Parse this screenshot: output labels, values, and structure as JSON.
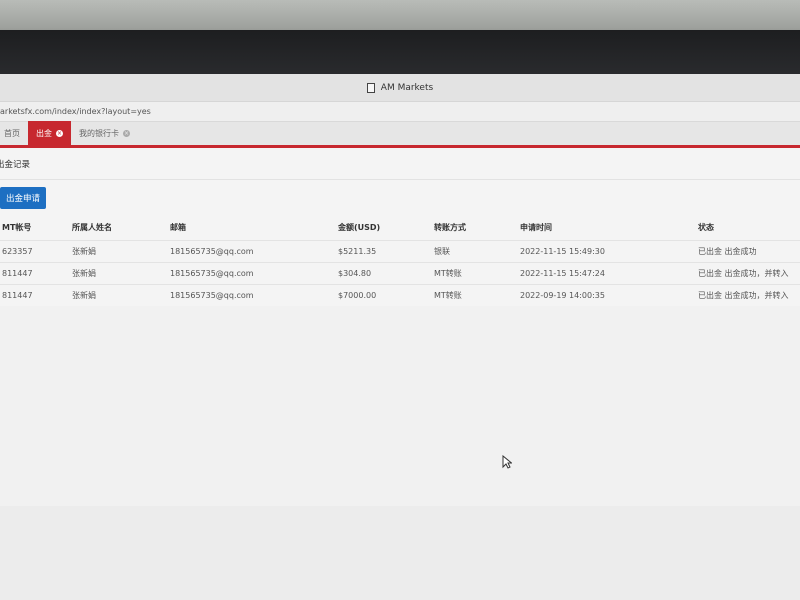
{
  "window": {
    "title": "AM Markets"
  },
  "address_bar": {
    "url": "arketsfx.com/index/index?layout=yes"
  },
  "tabs": [
    {
      "label": "首页",
      "active": false,
      "closable": false
    },
    {
      "label": "出金",
      "active": true,
      "closable": true
    },
    {
      "label": "我的银行卡",
      "active": false,
      "closable": true
    }
  ],
  "section": {
    "title": "出金记录"
  },
  "toolbar": {
    "apply_label": "出金申请"
  },
  "table": {
    "columns": [
      "MT帐号",
      "所属人姓名",
      "邮箱",
      "金额(USD)",
      "转账方式",
      "申请时间",
      "状态"
    ],
    "rows": [
      [
        "623357",
        "张新娟",
        "181565735@qq.com",
        "$5211.35",
        "银联",
        "2022-11-15 15:49:30",
        "已出金 出金成功"
      ],
      [
        "811447",
        "张新娟",
        "181565735@qq.com",
        "$304.80",
        "MT转账",
        "2022-11-15 15:47:24",
        "已出金 出金成功，并转入"
      ],
      [
        "811447",
        "张新娟",
        "181565735@qq.com",
        "$7000.00",
        "MT转账",
        "2022-09-19 14:00:35",
        "已出金 出金成功，并转入"
      ]
    ]
  },
  "colors": {
    "accent": "#c7282f",
    "primary_button": "#1d6fc2"
  }
}
